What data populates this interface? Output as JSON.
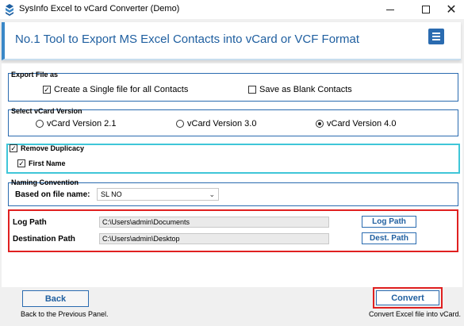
{
  "window": {
    "title": "SysInfo Excel to vCard Converter (Demo)"
  },
  "header": {
    "title": "No.1 Tool to Export MS Excel Contacts into vCard or VCF Format"
  },
  "export_file": {
    "legend": "Export File as",
    "single_file_label": "Create a Single file for all Contacts",
    "single_file_checked": true,
    "blank_label": "Save as Blank Contacts",
    "blank_checked": false
  },
  "vcard_version": {
    "legend": "Select vCard Version",
    "options": [
      "vCard Version 2.1",
      "vCard Version 3.0",
      "vCard Version 4.0"
    ],
    "selected": "vCard Version 4.0"
  },
  "duplicacy": {
    "remove_label": "Remove Duplicacy",
    "remove_checked": true,
    "first_name_label": "First Name",
    "first_name_checked": true
  },
  "naming": {
    "legend": "Naming Convention",
    "based_on_label": "Based on file name:",
    "selected": "SL NO"
  },
  "paths": {
    "log_label": "Log Path",
    "log_value": "C:\\Users\\admin\\Documents",
    "log_button": "Log Path",
    "dest_label": "Destination Path",
    "dest_value": "C:\\Users\\admin\\Desktop",
    "dest_button": "Dest. Path"
  },
  "footer": {
    "back_label": "Back",
    "back_hint": "Back to the Previous Panel.",
    "convert_label": "Convert",
    "convert_hint": "Convert Excel file into vCard."
  },
  "colors": {
    "accent": "#2a6bb0",
    "highlight": "#e02020",
    "duplicacy_border": "#3fc6d8"
  },
  "icons": [
    "app-icon",
    "minimize-icon",
    "maximize-icon",
    "close-icon",
    "hamburger-menu-icon",
    "chevron-down-icon"
  ]
}
